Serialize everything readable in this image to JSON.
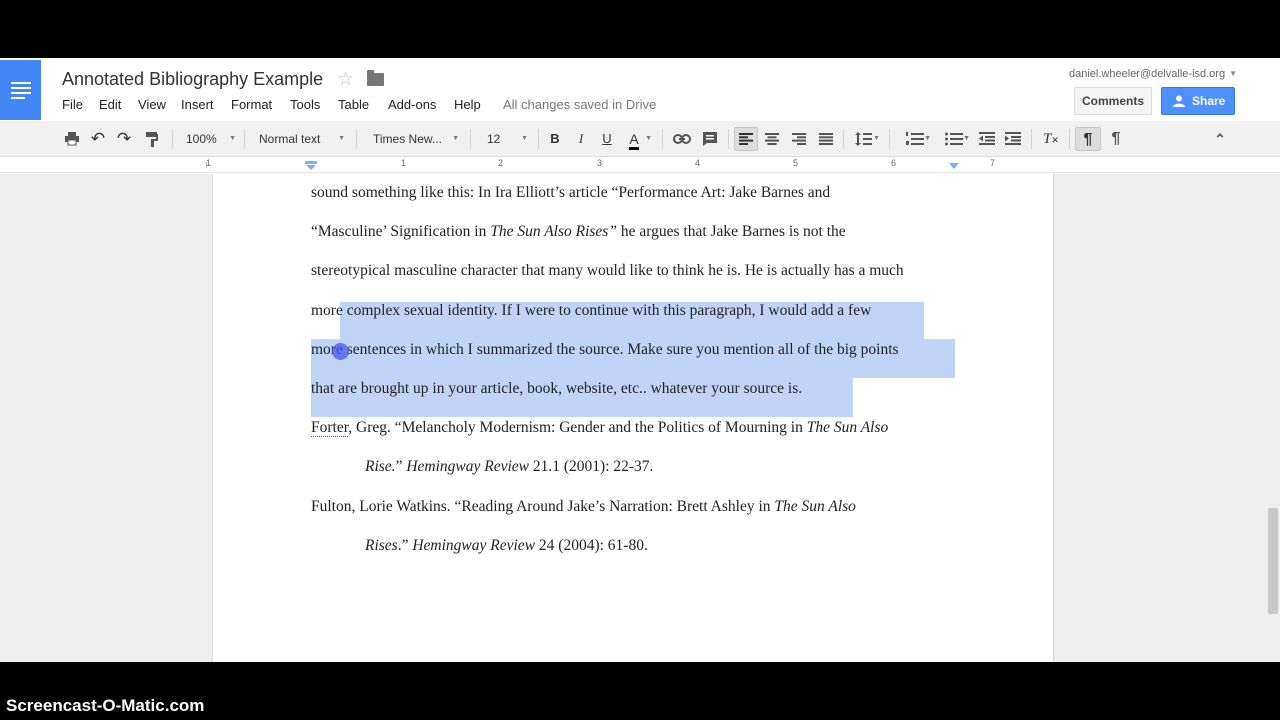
{
  "app": {
    "title": "Annotated Bibliography Example",
    "saved_status": "All changes saved in Drive",
    "user_email": "daniel.wheeler@delvalle-isd.org",
    "accent_color": "#4285f4"
  },
  "menu": [
    "File",
    "Edit",
    "View",
    "Insert",
    "Format",
    "Tools",
    "Table",
    "Add-ons",
    "Help"
  ],
  "buttons": {
    "comments": "Comments",
    "share": "Share"
  },
  "toolbar": {
    "zoom": "100%",
    "style": "Normal text",
    "font": "Times New...",
    "font_size": "12",
    "bold": "B",
    "italic": "I",
    "underline": "U",
    "text_color": "A"
  },
  "ruler_numbers": [
    "1",
    "1",
    "2",
    "3",
    "4",
    "5",
    "6",
    "7"
  ],
  "document": {
    "para_lines": [
      "sound something like this:  In Ira Elliott’s article “Performance Art: Jake Barnes and",
      "“Masculine’ Signification in ",
      "The Sun Also Rises”",
      " he argues that Jake Barnes is not the",
      "stereotypical masculine character that many would like to think he is. He is actually has a much",
      "more complex sexual identity. If I were to continue with this paragraph, I would add a few",
      "more sentences in which I summarized the source. Make sure you mention all of the big points",
      "that are brought up in your article, book, website, etc.. whatever your source is."
    ],
    "citations": [
      {
        "line1_a": "Forter",
        "line1_b": ", Greg. “Melancholy Modernism: Gender and the Politics of Mourning in ",
        "line1_i": "The Sun Also",
        "line2_i1": "Rise.",
        "line2_a": "” ",
        "line2_i2": "Hemingway Review",
        "line2_b": " 21.1 (2001): 22-37."
      },
      {
        "line1_b": "Fulton, Lorie Watkins. “Reading Around Jake’s Narration: Brett Ashley in ",
        "line1_i": "The Sun Also",
        "line2_i1": "Rises",
        "line2_a": ".” ",
        "line2_i2": "Hemingway Review",
        "line2_b": " 24 (2004): 61-80."
      }
    ]
  },
  "watermark": "Screencast-O-Matic.com"
}
